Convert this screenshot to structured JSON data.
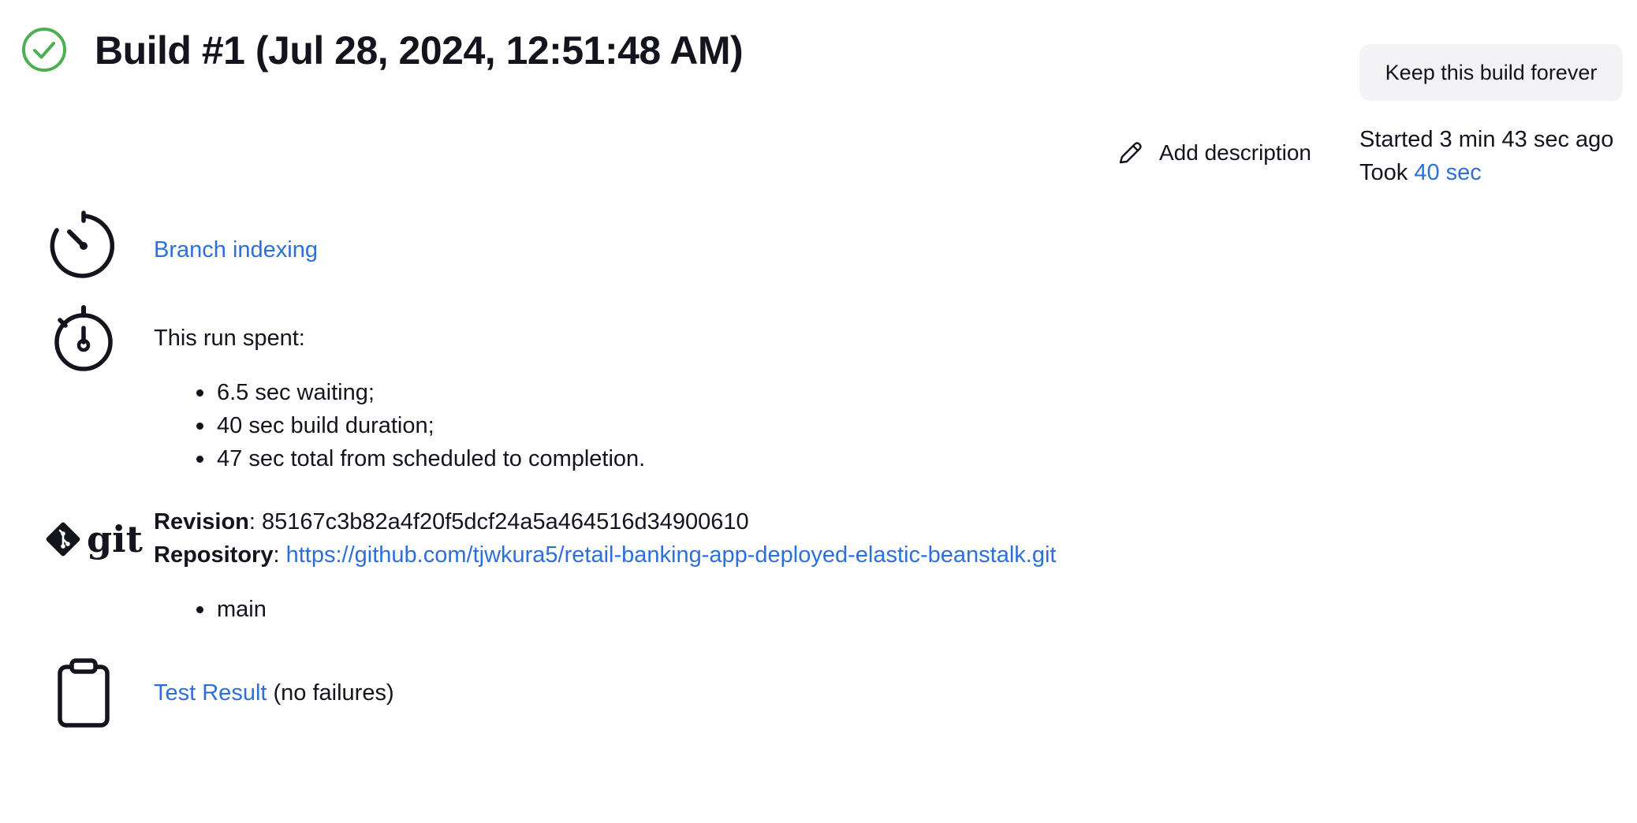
{
  "header": {
    "status_icon": "check-circle-icon",
    "status_color": "#4caf50",
    "title": "Build #1 (Jul 28, 2024, 12:51:48 AM)",
    "keep_button_label": "Keep this build forever"
  },
  "description": {
    "icon": "pencil-icon",
    "label": "Add description"
  },
  "build_meta": {
    "started": "Started 3 min 43 sec ago",
    "took_prefix": "Took",
    "took_value": "40 sec"
  },
  "cause": {
    "icon": "timer-icon",
    "link_label": "Branch indexing"
  },
  "timing": {
    "icon": "stopwatch-icon",
    "intro": "This run spent:",
    "items": [
      "6.5 sec waiting;",
      "40 sec build duration;",
      "47 sec total from scheduled to completion."
    ]
  },
  "git": {
    "icon": "git-logo-icon",
    "logo_text": "git",
    "revision_label": "Revision",
    "revision_value": "85167c3b82a4f20f5dcf24a5a464516d34900610",
    "repository_label": "Repository",
    "repository_url": "https://github.com/tjwkura5/retail-banking-app-deployed-elastic-beanstalk.git",
    "branches": [
      "main"
    ]
  },
  "tests": {
    "icon": "clipboard-icon",
    "link_label": "Test Result",
    "summary": "(no failures)"
  },
  "colors": {
    "link": "#2c6fd9",
    "text": "#14141f",
    "success": "#4caf50",
    "button_bg": "#f3f3f6"
  }
}
